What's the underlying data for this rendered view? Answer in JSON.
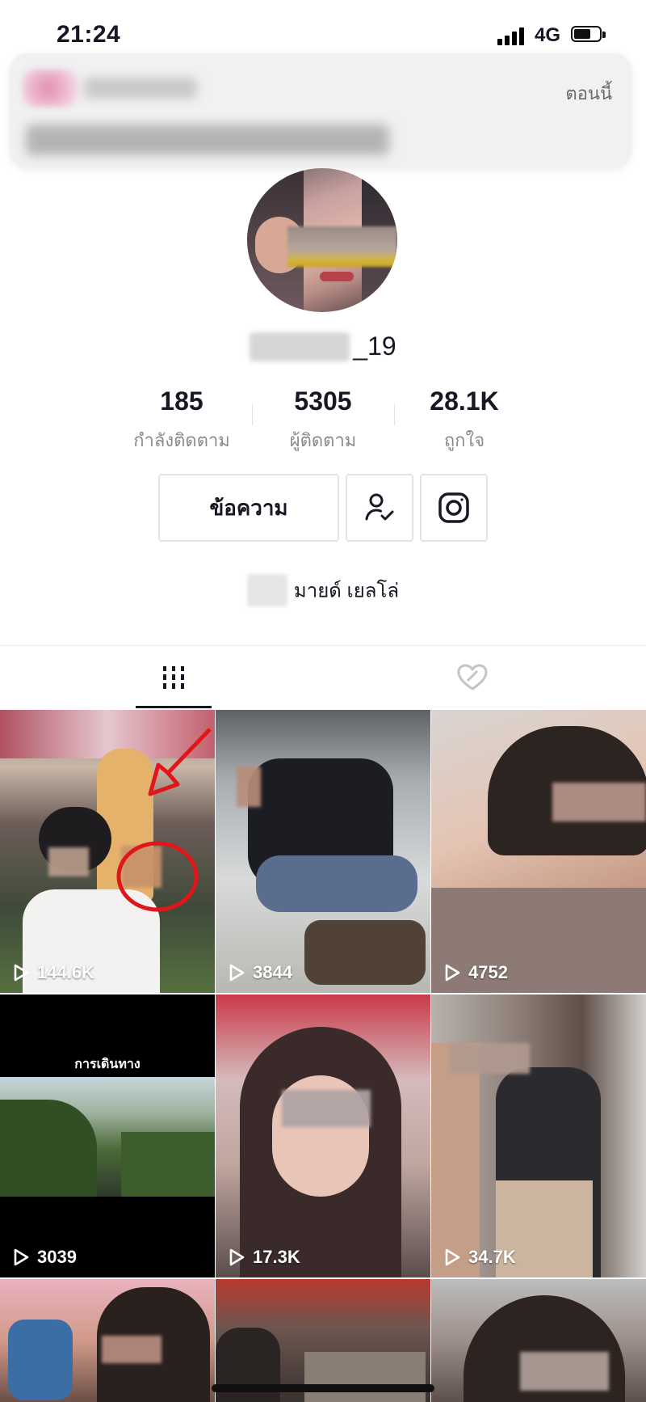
{
  "status_bar": {
    "time": "21:24",
    "network": "4G",
    "signal_bars": 4,
    "battery_level": 0.6
  },
  "notification": {
    "time": "ตอนนี้"
  },
  "profile": {
    "username_suffix": "_19",
    "stats": [
      {
        "value": "185",
        "label": "กำลังติดตาม"
      },
      {
        "value": "5305",
        "label": "ผู้ติดตาม"
      },
      {
        "value": "28.1K",
        "label": "ถูกใจ"
      }
    ],
    "message_button": "ข้อความ",
    "bio": "มายด์ เยลโล่"
  },
  "tabs": [
    {
      "icon": "grid-icon",
      "selected": true
    },
    {
      "icon": "liked-heart-icon",
      "selected": false
    }
  ],
  "videos": [
    {
      "views": "144.6K"
    },
    {
      "views": "3844"
    },
    {
      "views": "4752"
    },
    {
      "views": "3039",
      "caption": "การเดินทาง"
    },
    {
      "views": "17.3K"
    },
    {
      "views": "34.7K"
    },
    {},
    {},
    {}
  ],
  "colors": {
    "text": "#161823",
    "secondary_text": "#8a8b91",
    "annotation_red": "#e0161b"
  }
}
